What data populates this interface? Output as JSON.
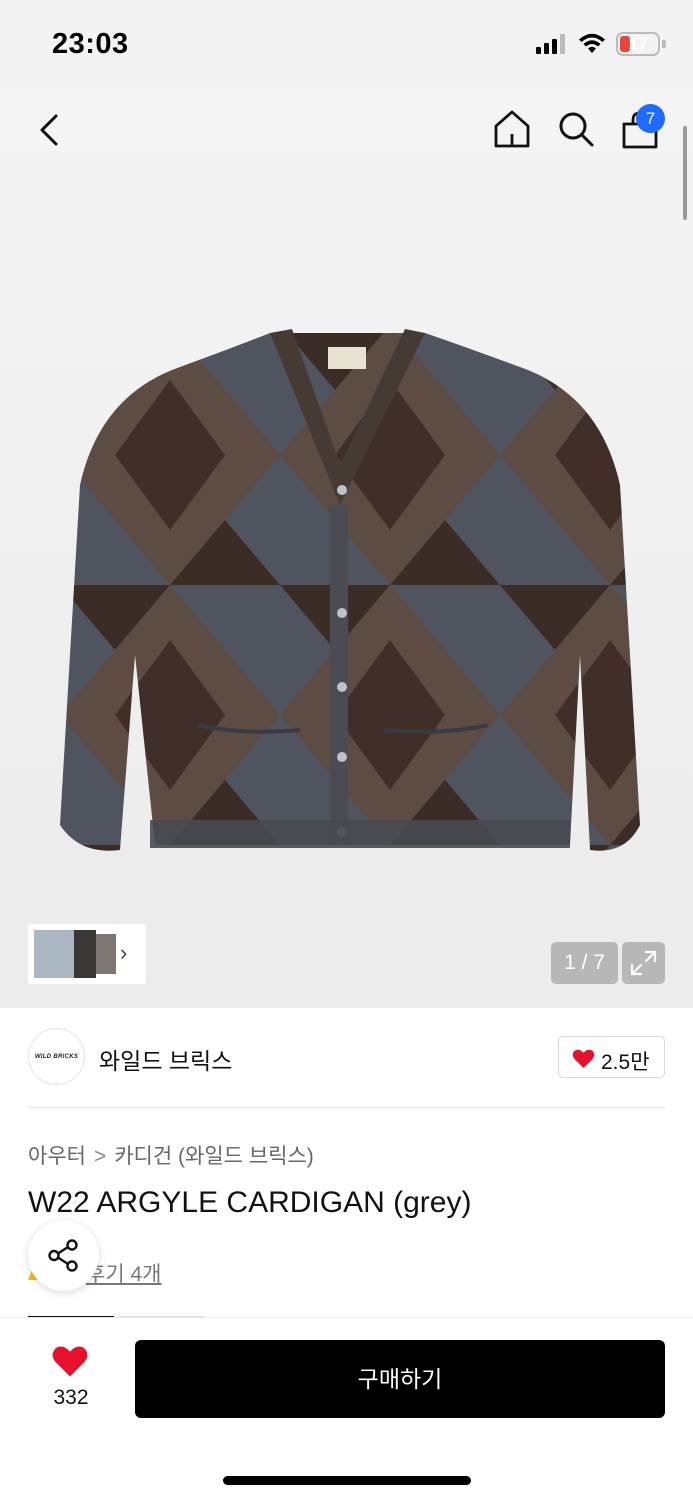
{
  "status_bar": {
    "time": "23:03",
    "battery": "17",
    "battery_level": 0.17
  },
  "header": {
    "cart_count": "7"
  },
  "gallery": {
    "counter": "1 / 7",
    "product_image": "grey argyle mohair cardigan",
    "label_text": "WILD BRICKS"
  },
  "brand": {
    "logo_text": "WILD BRICKS",
    "name": "와일드 브릭스",
    "likes": "2.5만"
  },
  "breadcrumb": {
    "level1": "아우터",
    "separator": ">",
    "level2": "카디건 (와일드 브릭스)"
  },
  "product": {
    "title": "W22 ARGYLE CARDIGAN (grey)",
    "reviews_label": "후기 4개"
  },
  "bottom_bar": {
    "wish_count": "332",
    "buy_label": "구매하기"
  },
  "colors": {
    "accent_blue": "#1f6bff",
    "heart_red": "#e8112d",
    "buy_black": "#000000"
  }
}
